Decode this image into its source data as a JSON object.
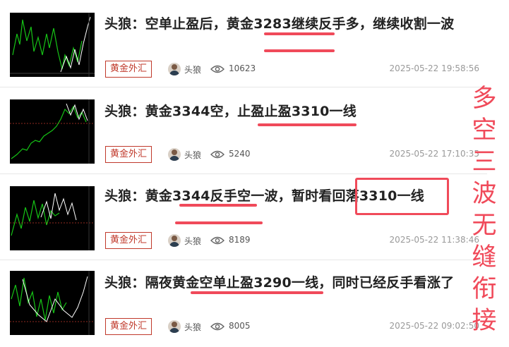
{
  "articles": [
    {
      "title": "头狼：空单止盈后，黄金3283继续反手多，继续收割一波",
      "tag": "黄金外汇",
      "author": "头狼",
      "views": "10623",
      "date": "2025-05-22 19:58:56"
    },
    {
      "title": "头狼：黄金3344空，止盈止盈3310一线",
      "tag": "黄金外汇",
      "author": "头狼",
      "views": "5240",
      "date": "2025-05-22 17:10:35"
    },
    {
      "title": "头狼：黄金3344反手空一波，暂时看回落3310一线",
      "tag": "黄金外汇",
      "author": "头狼",
      "views": "8189",
      "date": "2025-05-22 11:38:46"
    },
    {
      "title": "头狼：隔夜黄金空单止盈3290一线，同时已经反手看涨了",
      "tag": "黄金外汇",
      "author": "头狼",
      "views": "8005",
      "date": "2025-05-22 09:02:50"
    }
  ],
  "annotation": {
    "text": "多空三波无缝衔接",
    "color": "#f04a5a"
  }
}
